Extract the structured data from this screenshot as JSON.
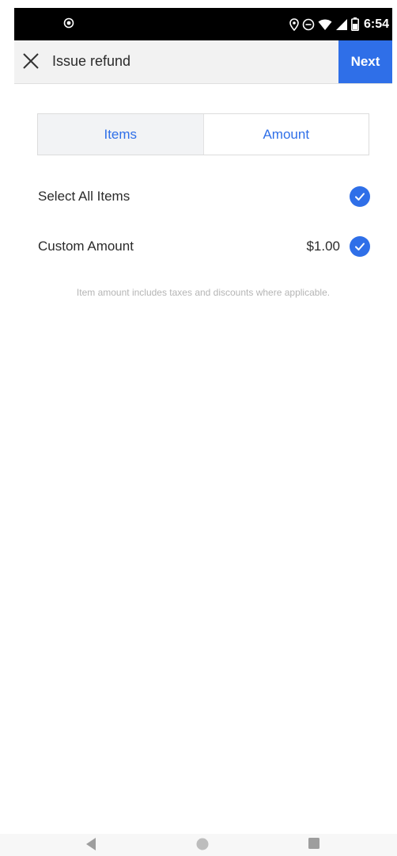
{
  "status_bar": {
    "time": "6:54",
    "icons": [
      "notification-dot-icon",
      "location-icon",
      "do-not-disturb-icon",
      "wifi-icon",
      "signal-icon",
      "battery-icon"
    ]
  },
  "header": {
    "title": "Issue refund",
    "next_label": "Next",
    "close_icon": "close-icon"
  },
  "tabs": [
    {
      "label": "Items",
      "selected": true
    },
    {
      "label": "Amount",
      "selected": false
    }
  ],
  "rows": [
    {
      "label": "Select All Items",
      "amount": "",
      "checked": true
    },
    {
      "label": "Custom Amount",
      "amount": "$1.00",
      "checked": true
    }
  ],
  "footnote": "Item amount includes taxes and discounts where applicable.",
  "nav": {
    "icons": [
      "back-icon",
      "home-icon",
      "recents-icon"
    ]
  },
  "colors": {
    "accent": "#2f6fe8",
    "header_bg": "#f2f2f2",
    "text": "#2b2b2b",
    "muted": "#b5b5b5"
  }
}
